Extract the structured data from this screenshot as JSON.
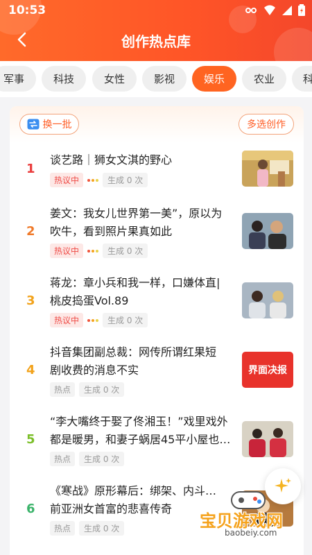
{
  "status": {
    "time": "10:53"
  },
  "header": {
    "title": "创作热点库"
  },
  "tabs": [
    {
      "label": "军事",
      "active": false
    },
    {
      "label": "科技",
      "active": false
    },
    {
      "label": "女性",
      "active": false
    },
    {
      "label": "影视",
      "active": false
    },
    {
      "label": "娱乐",
      "active": true
    },
    {
      "label": "农业",
      "active": false
    },
    {
      "label": "科",
      "active": false
    }
  ],
  "actions": {
    "refresh_label": "换一批",
    "multi_label": "多选创作"
  },
  "items": [
    {
      "rank": "1",
      "rank_color": "#ea3c3c",
      "title_l1": "谈艺路｜狮女文淇的野心",
      "title_l2": "",
      "tag": "热议中",
      "hot": true,
      "gen": "生成 0 次",
      "thumb_caption": ""
    },
    {
      "rank": "2",
      "rank_color": "#f07a2a",
      "title_l1": "姜文：我女儿世界第一美”，原以为",
      "title_l2": "吹牛，看到照片果真如此",
      "tag": "热议中",
      "hot": true,
      "gen": "生成 0 次",
      "thumb_caption": ""
    },
    {
      "rank": "3",
      "rank_color": "#f2a21a",
      "title_l1": "蒋龙：章小兵和我一样，口嫌体直|",
      "title_l2": "桃皮捣蛋Vol.89",
      "tag": "热议中",
      "hot": true,
      "gen": "生成 0 次",
      "thumb_caption": ""
    },
    {
      "rank": "4",
      "rank_color": "#f2a21a",
      "title_l1": "抖音集团副总裁：网传所谓红果短",
      "title_l2": "剧收费的消息不实",
      "tag": "热点",
      "hot": false,
      "gen": "生成 0 次",
      "thumb_caption": "界面决报"
    },
    {
      "rank": "5",
      "rank_color": "#7cbf2a",
      "title_l1": "“李大嘴终于娶了佟湘玉！”戏里戏外",
      "title_l2": "都是暖男，和妻子蜗居45平小屋也…",
      "tag": "热点",
      "hot": false,
      "gen": "生成 0 次",
      "thumb_caption": ""
    },
    {
      "rank": "6",
      "rank_color": "#3bb36a",
      "title_l1": "《寒战》原形幕后：绑架、内斗…",
      "title_l2": "前亚洲女首富的悲喜传奇",
      "tag": "热点",
      "hot": false,
      "gen": "生成 0 次",
      "thumb_caption": ""
    }
  ],
  "watermark": {
    "brand": "宝贝游戏网",
    "url": "baobeiy.com"
  },
  "colors": {
    "accent": "#ff6421",
    "hot_dots": [
      "#f0553c",
      "#f5a31e",
      "#e8d24a"
    ]
  }
}
